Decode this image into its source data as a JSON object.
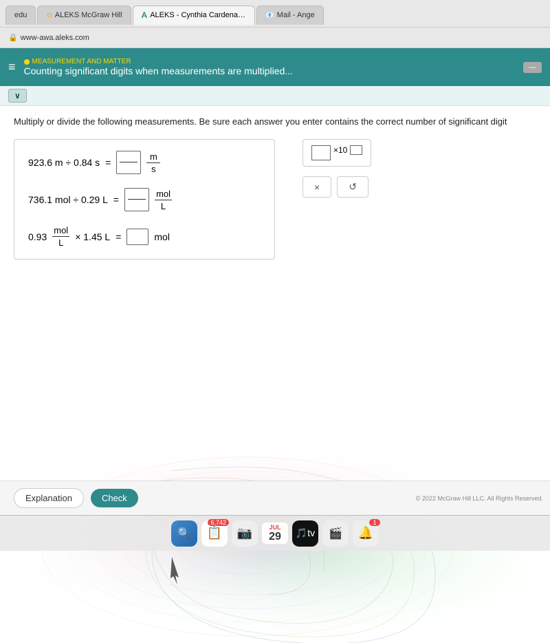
{
  "browser": {
    "address": "www-awa.aleks.com",
    "tabs": [
      {
        "id": "tab1",
        "label": "edu",
        "favicon": "🎓",
        "active": false
      },
      {
        "id": "tab2",
        "label": "ALEKS McGraw Hill",
        "favicon": "⊙",
        "active": false
      },
      {
        "id": "tab3",
        "label": "ALEKS - Cynthia Cardenas - Learn",
        "favicon": "A",
        "active": true
      },
      {
        "id": "tab4",
        "label": "Mail - Ange",
        "favicon": "📧",
        "active": false
      }
    ]
  },
  "header": {
    "category": "MEASUREMENT AND MATTER",
    "title": "Counting significant digits when measurements are multiplied...",
    "hamburger": "≡"
  },
  "instructions": "Multiply or divide the following measurements. Be sure each answer you enter contains the correct number of significant digit",
  "equations": [
    {
      "lhs": "923.6 m ÷ 0.84 s",
      "equals": "=",
      "answer_type": "fraction",
      "unit_num": "m",
      "unit_den": "s"
    },
    {
      "lhs": "736.1 mol ÷ 0.29 L",
      "equals": "=",
      "answer_type": "fraction",
      "unit_num": "mol",
      "unit_den": "L"
    },
    {
      "lhs_num": "mol",
      "lhs_den": "L",
      "lhs_coef": "0.93",
      "lhs_mult": "× 1.45 L",
      "equals": "=",
      "answer_type": "simple",
      "unit": "mol"
    }
  ],
  "right_panel": {
    "sci_notation_label": "×10",
    "btn_x": "×",
    "btn_undo": "↺"
  },
  "bottom": {
    "explanation_label": "Explanation",
    "check_label": "Check"
  },
  "dock": {
    "badge_count": "6,742",
    "date_month": "JUL",
    "date_day": "29",
    "items": [
      "🔍",
      "📷",
      "🎵",
      "📺",
      "🎬"
    ]
  },
  "copyright": "© 2022 McGraw Hill LLC. All Rights Reserved."
}
